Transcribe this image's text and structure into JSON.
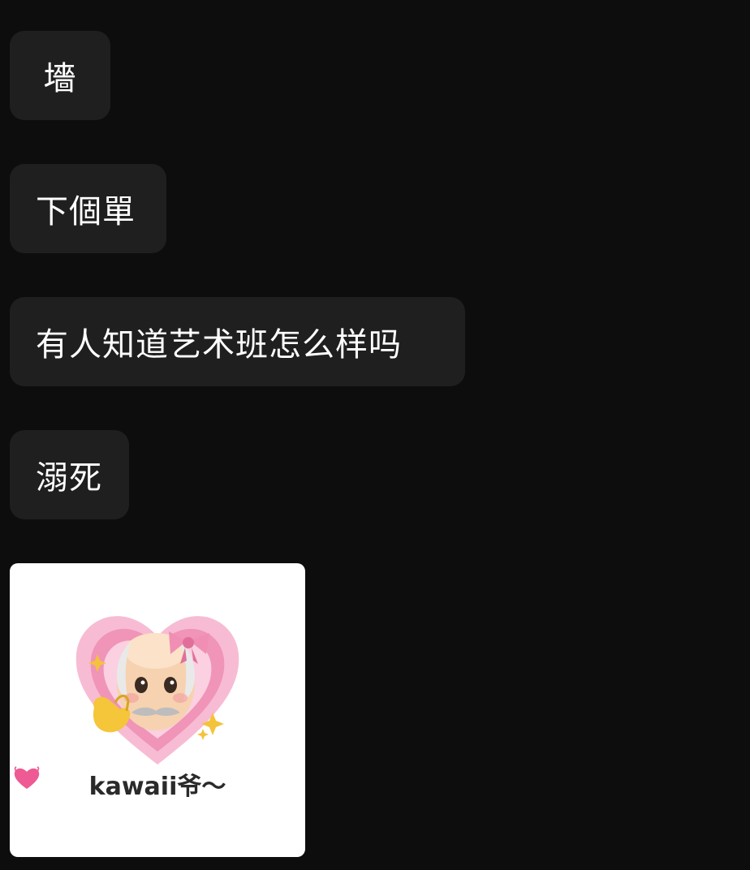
{
  "messages": [
    {
      "text": "墻"
    },
    {
      "text": "下個單"
    },
    {
      "text": "有人知道艺术班怎么样吗"
    },
    {
      "text": "溺死"
    }
  ],
  "sticker": {
    "caption": "kawaii爷～",
    "icons": [
      "heart-icon",
      "old-man-emoji",
      "bow-icon",
      "sparkle-icon",
      "hand-heart-icon"
    ]
  },
  "colors": {
    "background": "#0d0d0d",
    "bubble": "#1f1f1f",
    "text": "#ffffff",
    "heart_pink": "#f4a9c8"
  }
}
